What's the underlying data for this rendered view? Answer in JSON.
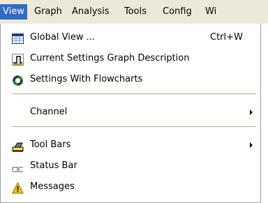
{
  "menubar": {
    "items": [
      {
        "label": "View"
      },
      {
        "label": "Graph"
      },
      {
        "label": "Analysis"
      },
      {
        "label": "Tools"
      },
      {
        "label": "Config"
      },
      {
        "label": "Wi"
      }
    ]
  },
  "menu": {
    "items": [
      {
        "label": "Global View ...",
        "shortcut": "Ctrl+W",
        "icon": "global-view-icon"
      },
      {
        "label": "Current Settings Graph Description",
        "icon": "graph-description-icon"
      },
      {
        "label": "Settings With Flowcharts",
        "icon": "flowchart-settings-icon"
      },
      {
        "label": "Channel",
        "submenu": true
      },
      {
        "label": "Tool Bars",
        "submenu": true,
        "icon": "toolbars-icon"
      },
      {
        "label": "Status Bar",
        "icon": "status-bar-icon"
      },
      {
        "label": "Messages",
        "icon": "warning-icon"
      }
    ]
  },
  "colors": {
    "menubar_bg": "#ece9d8",
    "highlight_bg": "#316ac5",
    "highlight_text": "#ffffff",
    "warning_yellow": "#f5c400",
    "icon_green": "#2e8b2e"
  }
}
